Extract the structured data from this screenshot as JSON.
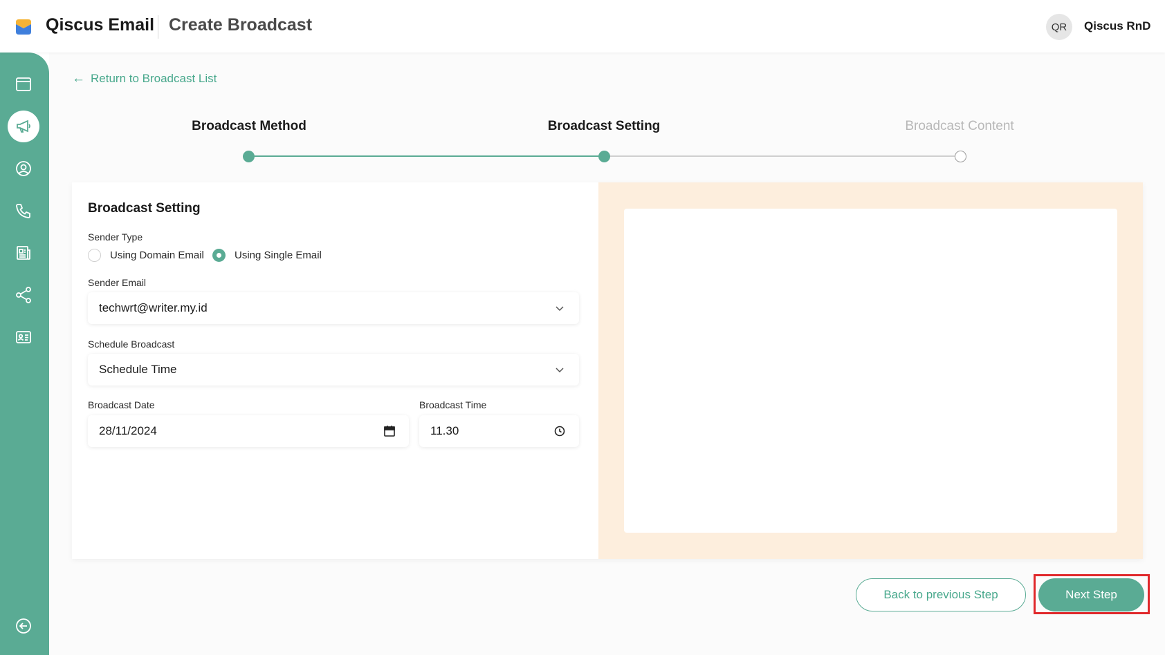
{
  "header": {
    "brand": "Qiscus Email",
    "page_title": "Create Broadcast",
    "avatar_initials": "QR",
    "username": "Qiscus RnD"
  },
  "sidebar": {
    "items": [
      {
        "icon": "window-icon",
        "active": false
      },
      {
        "icon": "megaphone-icon",
        "active": true
      },
      {
        "icon": "user-circle-icon",
        "active": false
      },
      {
        "icon": "phone-icon",
        "active": false
      },
      {
        "icon": "newspaper-icon",
        "active": false
      },
      {
        "icon": "share-icon",
        "active": false
      },
      {
        "icon": "id-card-icon",
        "active": false
      },
      {
        "icon": "collapse-left-icon",
        "active": false
      }
    ]
  },
  "nav": {
    "return_label": "Return to Broadcast List"
  },
  "stepper": {
    "steps": [
      {
        "label": "Broadcast Method",
        "state": "done"
      },
      {
        "label": "Broadcast Setting",
        "state": "current"
      },
      {
        "label": "Broadcast Content",
        "state": "pending"
      }
    ]
  },
  "form": {
    "title": "Broadcast Setting",
    "sender_type_label": "Sender Type",
    "sender_type_options": [
      "Using Domain Email",
      "Using Single Email"
    ],
    "sender_type_selected": "Using Single Email",
    "sender_email_label": "Sender Email",
    "sender_email_value": "techwrt@writer.my.id",
    "schedule_label": "Schedule Broadcast",
    "schedule_value": "Schedule Time",
    "date_label": "Broadcast Date",
    "date_value": "28/11/2024",
    "time_label": "Broadcast Time",
    "time_value": "11.30"
  },
  "actions": {
    "back_label": "Back to previous Step",
    "next_label": "Next Step"
  },
  "colors": {
    "accent": "#5aab94",
    "preview_bg": "#fdeedd",
    "highlight": "#e0282b"
  }
}
